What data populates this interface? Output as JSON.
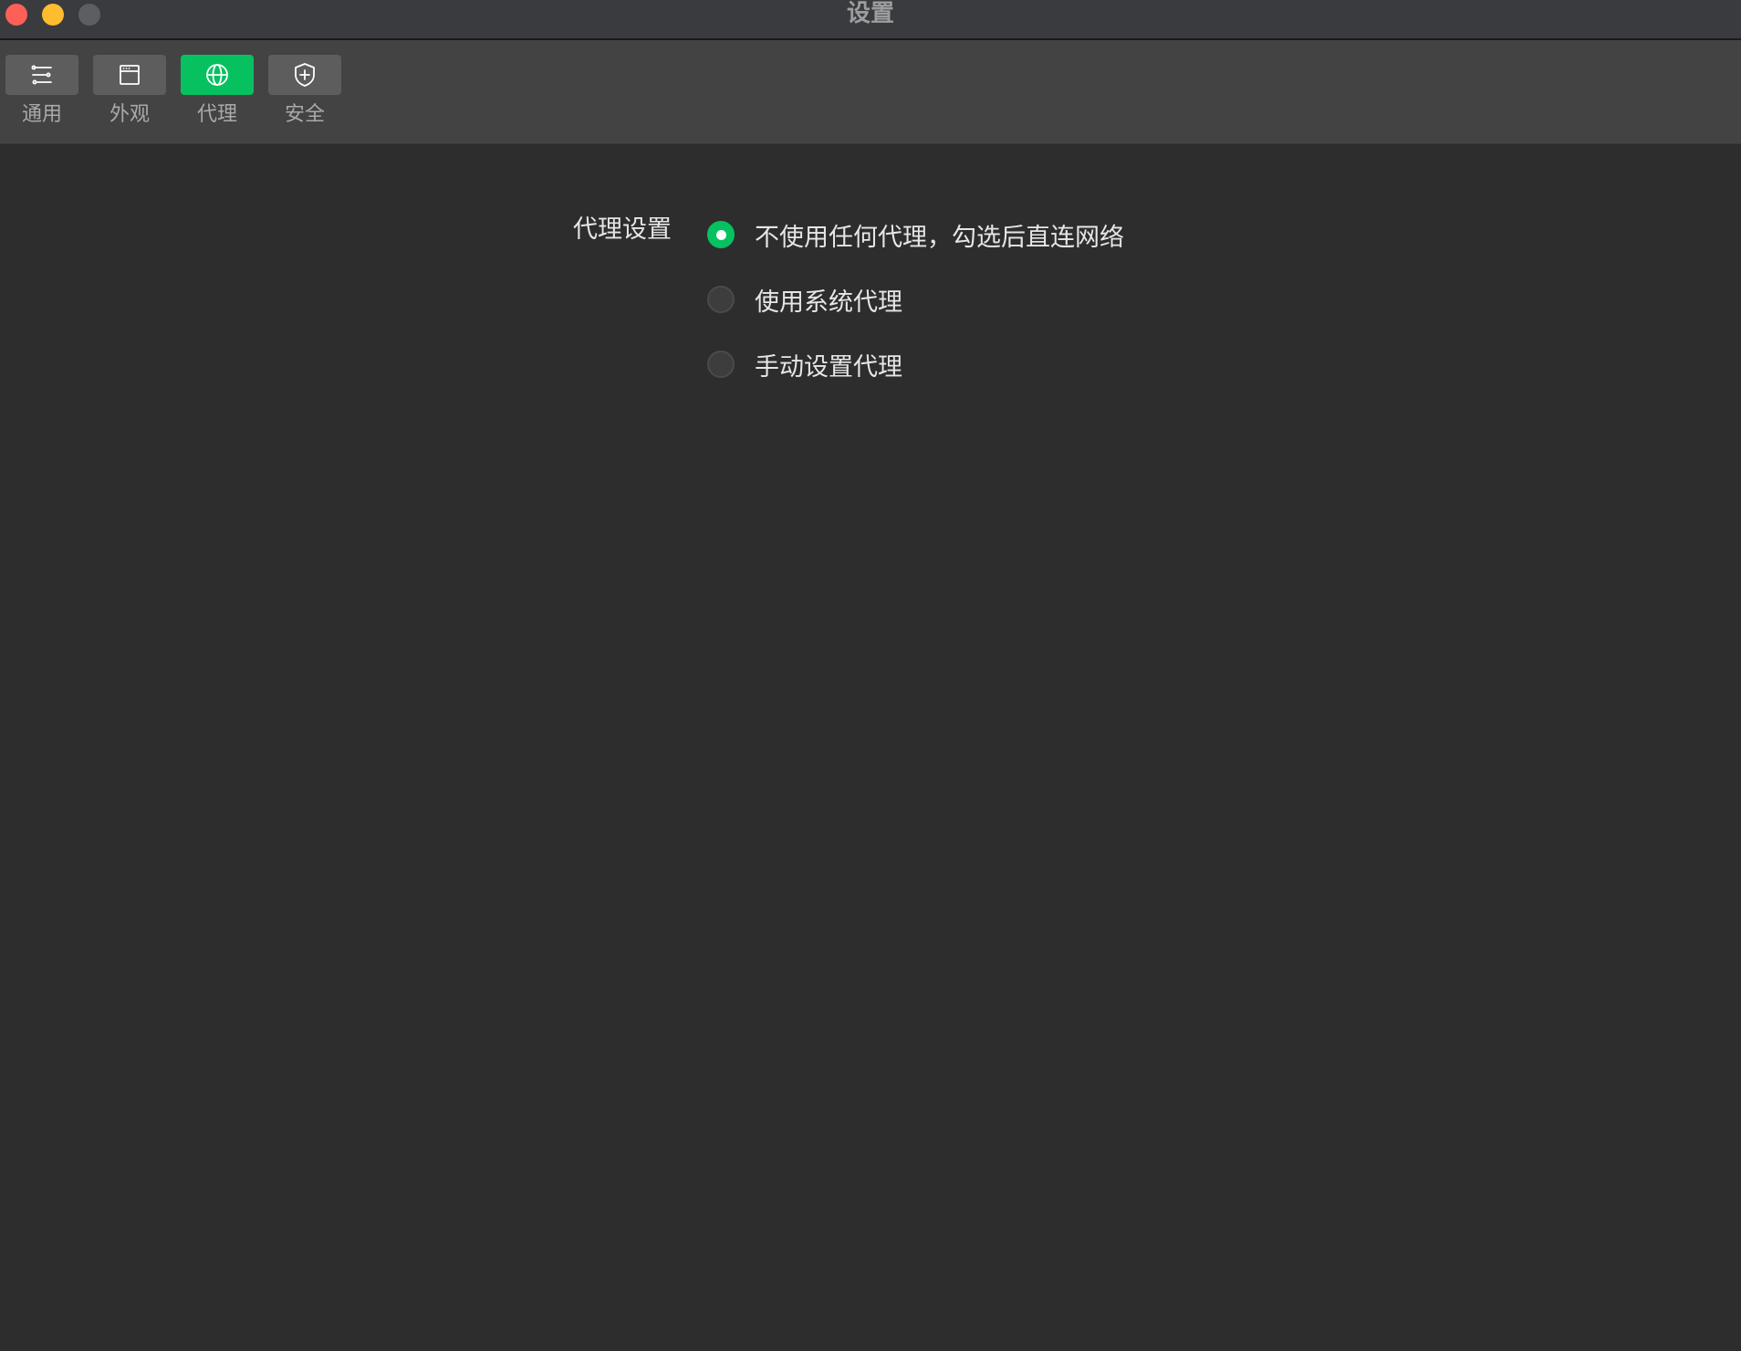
{
  "window": {
    "title": "设置",
    "controls": {
      "close_color": "#fe5f57",
      "minimize_color": "#febc2e",
      "zoom_color": "#5d5e61"
    }
  },
  "toolbar": {
    "accent_color": "#07c160",
    "items": [
      {
        "label": "通用",
        "icon": "sliders-icon",
        "active": false
      },
      {
        "label": "外观",
        "icon": "window-icon",
        "active": false
      },
      {
        "label": "代理",
        "icon": "globe-icon",
        "active": true
      },
      {
        "label": "安全",
        "icon": "shield-plus-icon",
        "active": false
      }
    ]
  },
  "proxy": {
    "section_label": "代理设置",
    "options": [
      {
        "label": "不使用任何代理，勾选后直连网络",
        "selected": true
      },
      {
        "label": "使用系统代理",
        "selected": false
      },
      {
        "label": "手动设置代理",
        "selected": false
      }
    ]
  }
}
